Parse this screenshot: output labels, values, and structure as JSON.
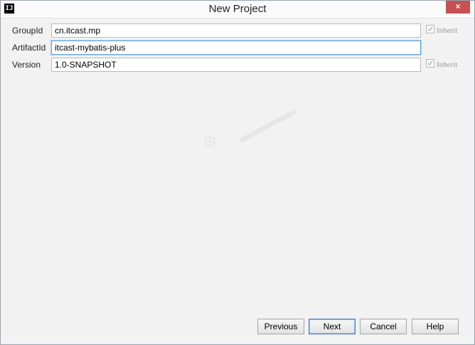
{
  "window": {
    "title": "New Project",
    "app_icon_text": "IJ",
    "close_glyph": "×"
  },
  "form": {
    "group_id": {
      "label": "GroupId",
      "value": "cn.itcast.mp",
      "inherit_label": "Inherit"
    },
    "artifact_id": {
      "label": "ArtifactId",
      "value": "itcast-mybatis-plus"
    },
    "version": {
      "label": "Version",
      "value": "1.0-SNAPSHOT",
      "inherit_label": "Inherit"
    }
  },
  "buttons": {
    "previous": "Previous",
    "next": "Next",
    "cancel": "Cancel",
    "help": "Help"
  },
  "colors": {
    "accent": "#3d7fcf",
    "close": "#c75050"
  }
}
